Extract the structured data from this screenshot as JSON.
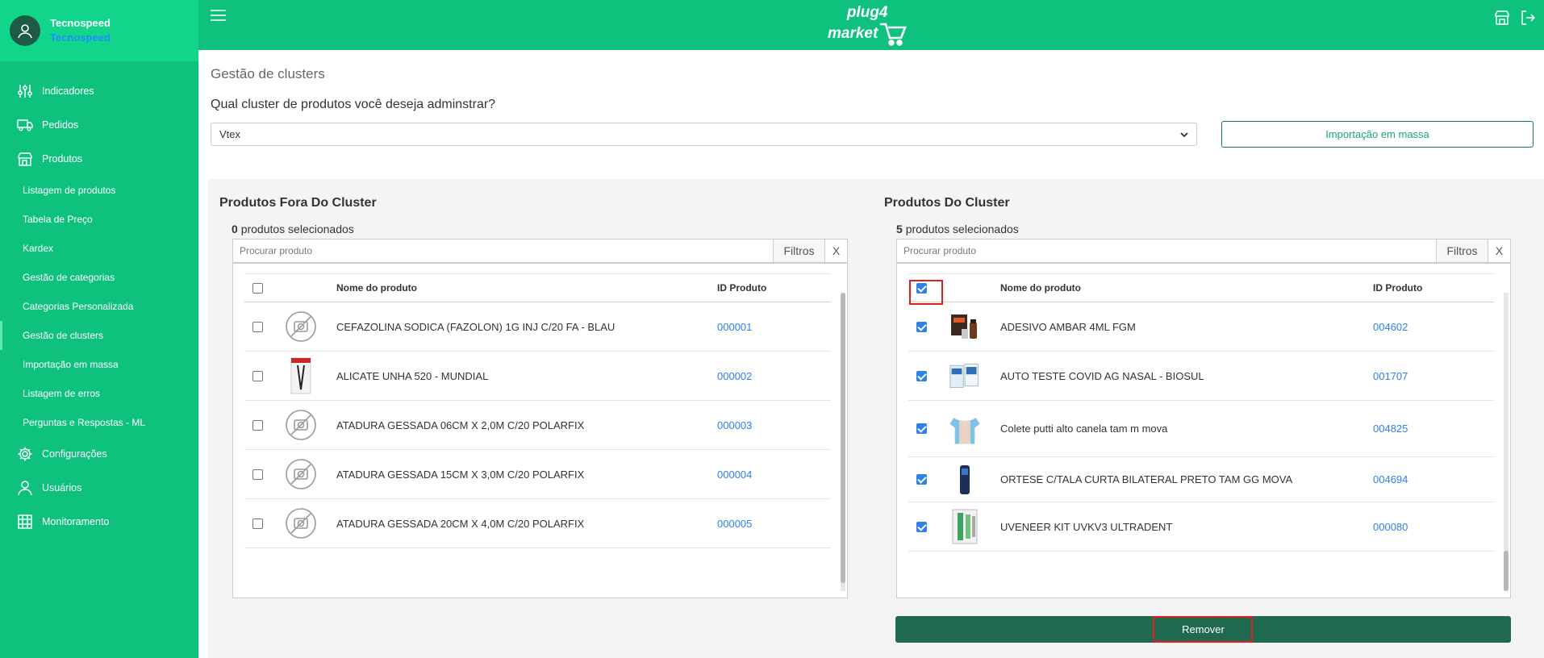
{
  "user": {
    "name": "Tecnospeed",
    "company": "Tecnospeed"
  },
  "brand": {
    "logo_line1": "plug4",
    "logo_line2": "market"
  },
  "colors": {
    "accent": "#0ec27e",
    "primary_dark": "#1e6950",
    "link": "#2f80ed",
    "highlight": "#e21d1d"
  },
  "menu": [
    {
      "label": "Indicadores",
      "icon": "sliders-icon"
    },
    {
      "label": "Pedidos",
      "icon": "truck-icon"
    },
    {
      "label": "Produtos",
      "icon": "store-icon"
    }
  ],
  "submenu": [
    {
      "label": "Listagem de produtos"
    },
    {
      "label": "Tabela de Preço"
    },
    {
      "label": "Kardex"
    },
    {
      "label": "Gestão de categorias"
    },
    {
      "label": "Categorias Personalizada"
    },
    {
      "label": "Gestão de clusters",
      "active": true
    },
    {
      "label": "Importação em massa"
    },
    {
      "label": "Listagem de erros"
    },
    {
      "label": "Perguntas e Respostas - ML"
    }
  ],
  "menu_bottom": [
    {
      "label": "Configurações",
      "icon": "gear-icon"
    },
    {
      "label": "Usuários",
      "icon": "user-icon"
    },
    {
      "label": "Monitoramento",
      "icon": "building-icon"
    }
  ],
  "page": {
    "title": "Gestão de clusters",
    "question": "Qual cluster de produtos você deseja adminstrar?",
    "selected_cluster": "Vtex",
    "mass_import_label": "Importação em massa"
  },
  "left_panel": {
    "title": "Produtos Fora Do Cluster",
    "selected_count": "0",
    "selected_suffix": "produtos selecionados",
    "search_placeholder": "Procurar produto",
    "filters_label": "Filtros",
    "clear_label": "X",
    "col_name": "Nome do produto",
    "col_id": "ID Produto",
    "header_checked": false,
    "rows": [
      {
        "name": "CEFAZOLINA SODICA (FAZOLON) 1G INJ C/20 FA - BLAU",
        "id": "000001",
        "checked": false,
        "image": "no-image-icon"
      },
      {
        "name": "ALICATE UNHA 520 - MUNDIAL",
        "id": "000002",
        "checked": false,
        "image": "nail-clipper-photo"
      },
      {
        "name": "ATADURA GESSADA 06CM X 2,0M C/20 POLARFIX",
        "id": "000003",
        "checked": false,
        "image": "no-image-icon"
      },
      {
        "name": "ATADURA GESSADA 15CM X 3,0M C/20 POLARFIX",
        "id": "000004",
        "checked": false,
        "image": "no-image-icon"
      },
      {
        "name": "ATADURA GESSADA 20CM X 4,0M C/20 POLARFIX",
        "id": "000005",
        "checked": false,
        "image": "no-image-icon"
      }
    ]
  },
  "right_panel": {
    "title": "Produtos Do Cluster",
    "selected_count": "5",
    "selected_suffix": "produtos selecionados",
    "search_placeholder": "Procurar produto",
    "filters_label": "Filtros",
    "clear_label": "X",
    "col_name": "Nome do produto",
    "col_id": "ID Produto",
    "header_checked": true,
    "rows": [
      {
        "name": "ADESIVO AMBAR 4ML FGM",
        "id": "004602",
        "checked": true,
        "image": "adhesive-kit-photo"
      },
      {
        "name": "AUTO TESTE COVID AG NASAL - BIOSUL",
        "id": "001707",
        "checked": true,
        "image": "covid-test-photo"
      },
      {
        "name": "Colete putti alto canela tam m mova",
        "id": "004825",
        "checked": true,
        "image": "vest-photo"
      },
      {
        "name": "ORTESE C/TALA CURTA BILATERAL PRETO TAM GG MOVA",
        "id": "004694",
        "checked": true,
        "image": "orthosis-photo"
      },
      {
        "name": "UVENEER KIT UVKV3 ULTRADENT",
        "id": "000080",
        "checked": true,
        "image": "uveneer-kit-photo"
      }
    ],
    "remove_label": "Remover"
  }
}
